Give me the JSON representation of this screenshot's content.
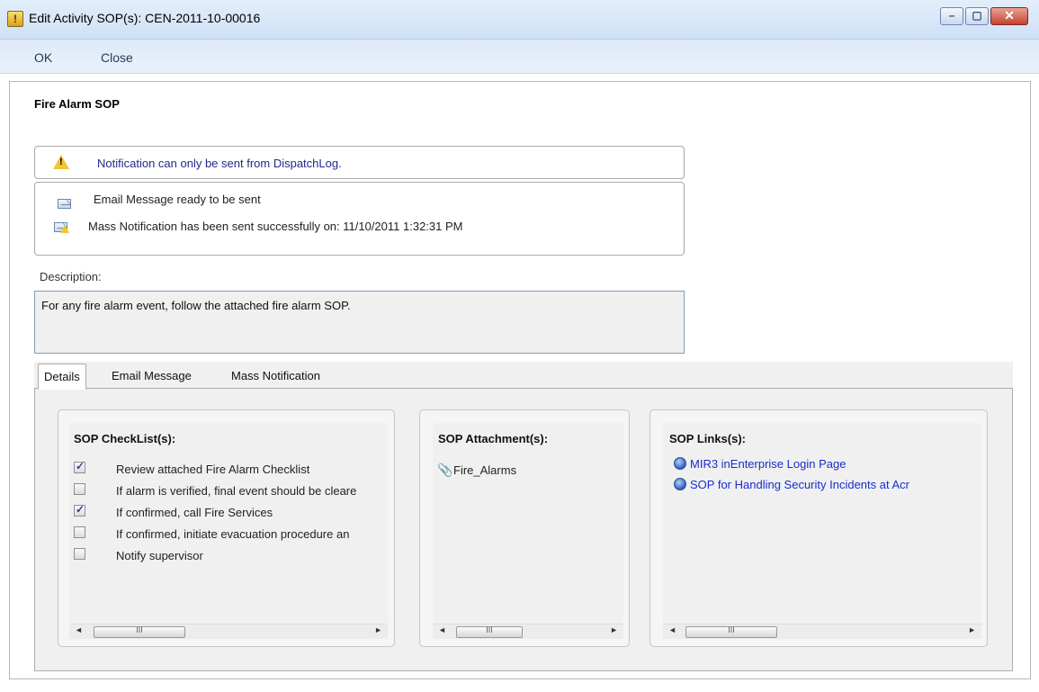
{
  "window": {
    "title": "Edit Activity SOP(s): CEN-2011-10-00016",
    "icon_label": "!",
    "minimize_glyph": "–",
    "maximize_glyph": "▢",
    "close_glyph": "✕"
  },
  "menu": {
    "ok_label": "OK",
    "close_label": "Close"
  },
  "sop": {
    "title": "Fire Alarm SOP"
  },
  "alert": {
    "warning_text": "Notification can only be sent from DispatchLog."
  },
  "status": {
    "email_text": "Email Message ready to be sent",
    "mass_text": "Mass Notification has been sent successfully on: 11/10/2011 1:32:31 PM"
  },
  "description": {
    "label": "Description:",
    "text": "For any fire alarm event, follow the attached fire alarm SOP."
  },
  "tabs": [
    {
      "label": "Details",
      "active": true
    },
    {
      "label": "Email Message",
      "active": false
    },
    {
      "label": "Mass Notification",
      "active": false
    }
  ],
  "checklist": {
    "title": "SOP CheckList(s):",
    "items": [
      {
        "label": "Review attached Fire Alarm Checklist",
        "checked": true
      },
      {
        "label": "If alarm is verified, final event should be cleare",
        "checked": false
      },
      {
        "label": "If confirmed, call Fire Services",
        "checked": true
      },
      {
        "label": "If confirmed, initiate evacuation procedure an",
        "checked": false
      },
      {
        "label": "Notify supervisor",
        "checked": false
      }
    ]
  },
  "attachments": {
    "title": "SOP Attachment(s):",
    "items": [
      "Fire_Alarms"
    ]
  },
  "links": {
    "title": "SOP Links(s):",
    "items": [
      "MIR3 inEnterprise Login Page",
      "SOP for Handling Security Incidents at Acr"
    ]
  },
  "scrollbar": {
    "left_arrow": "◄",
    "right_arrow": "►",
    "grip": "III"
  },
  "colors": {
    "warning_text": "#1f2a8c",
    "link_text": "#1a2ccf",
    "titlebar": "#dbe8f7"
  }
}
